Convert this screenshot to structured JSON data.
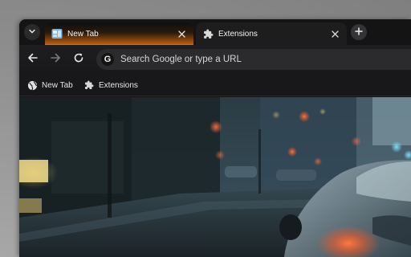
{
  "browser": {
    "tabs": [
      {
        "title": "New Tab",
        "icon": "new-tab-favicon-icon",
        "active": true
      },
      {
        "title": "Extensions",
        "icon": "puzzle-icon",
        "active": false
      }
    ],
    "toolbar": {
      "back_icon": "arrow-left-icon",
      "forward_icon": "arrow-right-icon",
      "reload_icon": "reload-icon",
      "search_engine_logo": "G",
      "omnibox_placeholder": "Search Google or type a URL"
    },
    "bookmarks": [
      {
        "label": "New Tab",
        "icon": "globe-icon"
      },
      {
        "label": "Extensions",
        "icon": "puzzle-icon"
      }
    ],
    "theme": {
      "accent": "#d06a13",
      "frame": "#141414",
      "toolbar": "#1e1e20"
    }
  },
  "page": {
    "background_image": "rainy-city-street-photo"
  }
}
